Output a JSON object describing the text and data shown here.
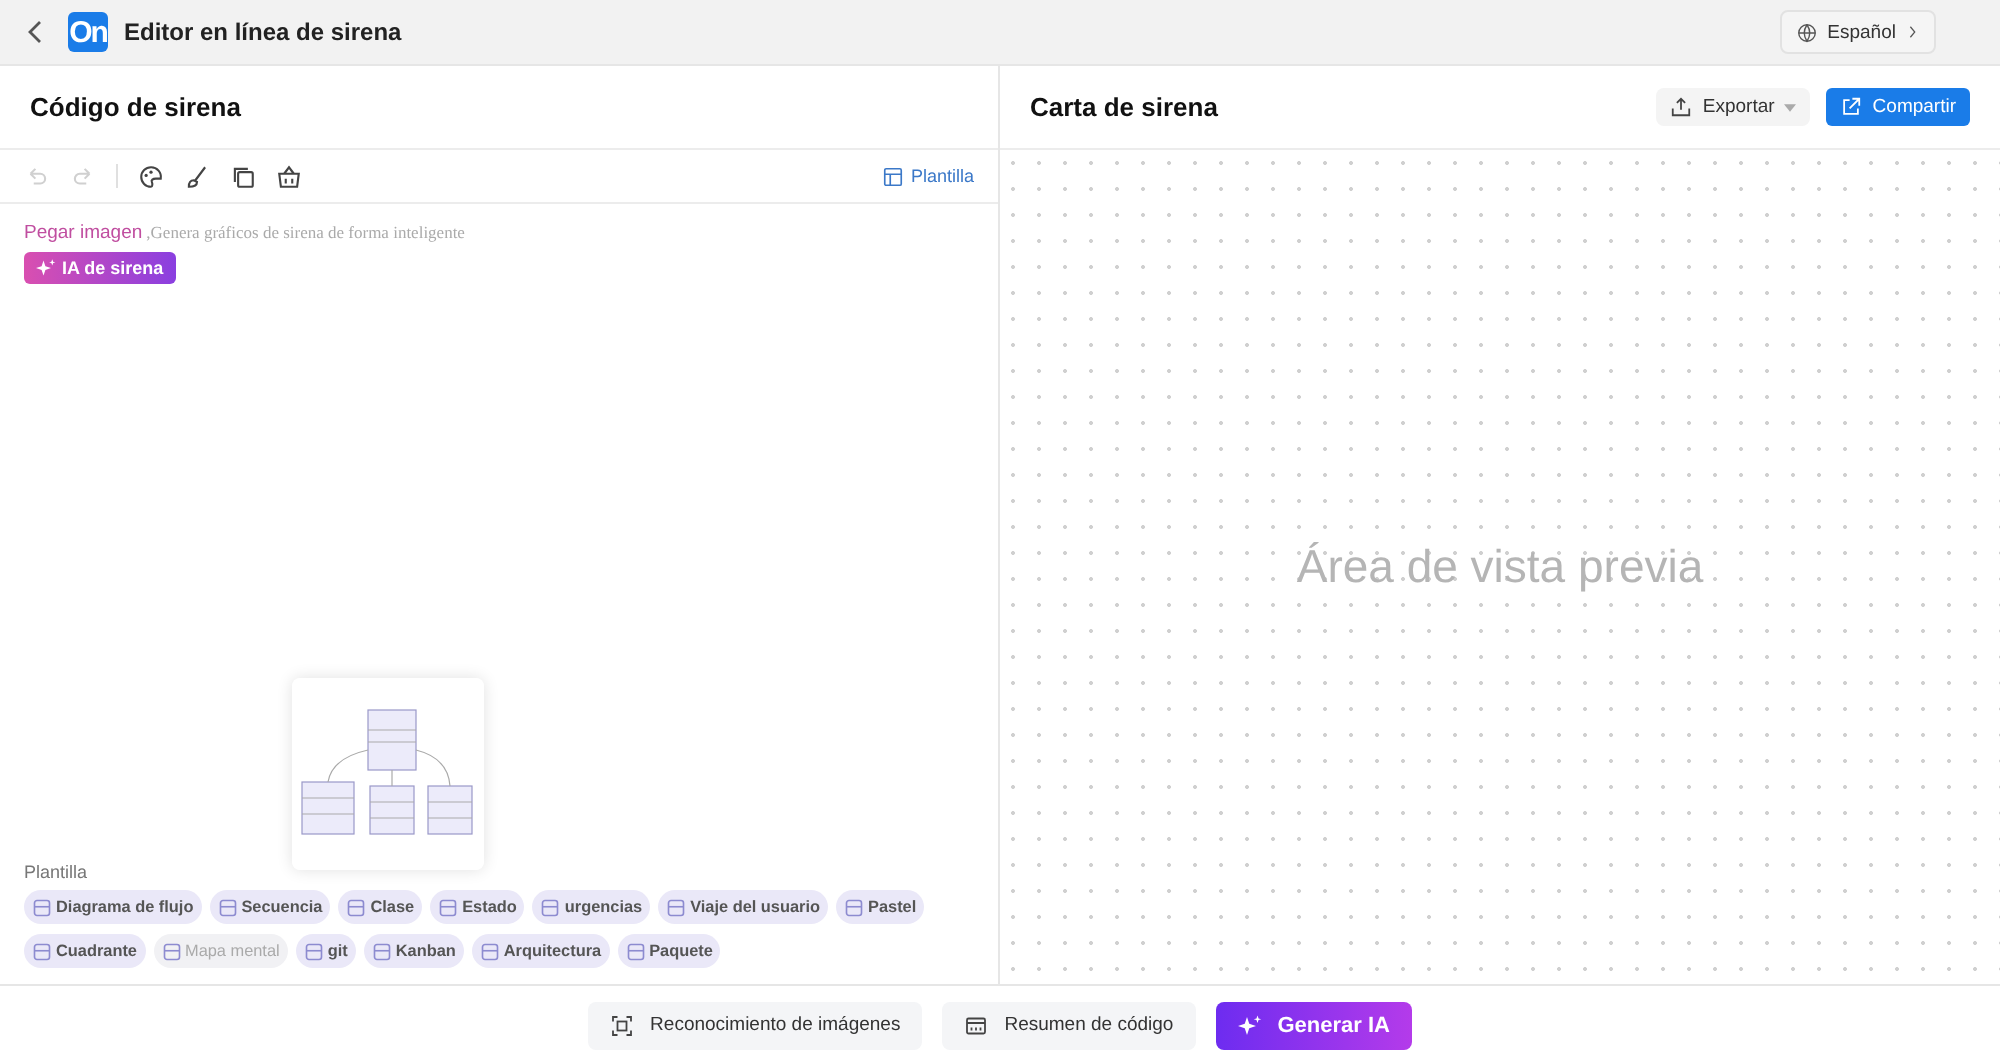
{
  "header": {
    "title": "Editor en línea de sirena",
    "logo": "On",
    "language": "Español"
  },
  "code_panel": {
    "title": "Código de sirena",
    "template_button": "Plantilla",
    "toolbar": [
      {
        "kind": "undo",
        "disabled": true
      },
      {
        "kind": "redo",
        "disabled": true
      },
      {
        "kind": "palette",
        "disabled": false
      },
      {
        "kind": "brush",
        "disabled": false
      },
      {
        "kind": "copy",
        "disabled": false
      },
      {
        "kind": "basket",
        "disabled": false
      }
    ],
    "paste_link": "Pegar imagen",
    "hint": ",Genera gráficos de sirena de forma inteligente",
    "ai_badge": "IA de sirena",
    "template_label": "Plantilla",
    "templates": [
      {
        "label": "Diagrama de flujo",
        "disabled": false
      },
      {
        "label": "Secuencia",
        "disabled": false
      },
      {
        "label": "Clase",
        "disabled": false
      },
      {
        "label": "Estado",
        "disabled": false
      },
      {
        "label": "urgencias",
        "disabled": false
      },
      {
        "label": "Viaje del usuario",
        "disabled": false
      },
      {
        "label": "Pastel",
        "disabled": false
      },
      {
        "label": "Cuadrante",
        "disabled": false
      },
      {
        "label": "Mapa mental",
        "disabled": true
      },
      {
        "label": "git",
        "disabled": false
      },
      {
        "label": "Kanban",
        "disabled": false
      },
      {
        "label": "Arquitectura",
        "disabled": false
      },
      {
        "label": "Paquete",
        "disabled": false
      }
    ]
  },
  "chart_panel": {
    "title": "Carta de sirena",
    "export_button": "Exportar",
    "share_button": "Compartir",
    "empty_message": "Área de vista previa"
  },
  "footer": {
    "buttons": [
      {
        "kind": "image",
        "label": "Reconocimiento de imágenes"
      },
      {
        "kind": "summary",
        "label": "Resumen de código"
      },
      {
        "kind": "ai",
        "label": "Generar IA"
      }
    ]
  }
}
